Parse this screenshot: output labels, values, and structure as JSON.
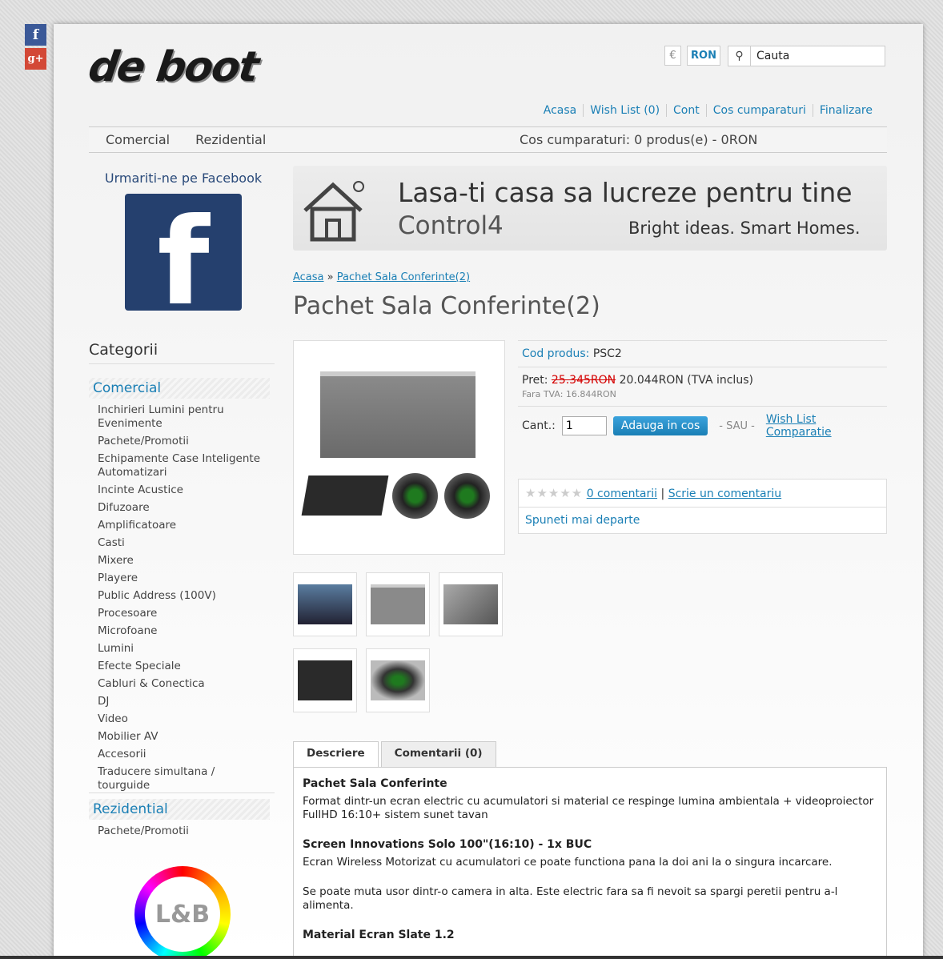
{
  "social": {
    "fb": "f",
    "gp": "g+"
  },
  "brand": {
    "logo_text": "de boot"
  },
  "currency": {
    "eur": "€",
    "ron": "RON"
  },
  "search": {
    "value": "Cauta"
  },
  "toplinks": [
    "Acasa",
    "Wish List (0)",
    "Cont",
    "Cos cumparaturi",
    "Finalizare"
  ],
  "menu": {
    "items": [
      "Comercial",
      "Rezidential"
    ],
    "cart": "Cos cumparaturi: 0 produs(e) - 0RON"
  },
  "facebook": {
    "title": "Urmariti-ne pe Facebook",
    "letter": "f"
  },
  "categories": {
    "heading": "Categorii",
    "comercial": {
      "title": "Comercial",
      "items": [
        "Inchirieri Lumini pentru Evenimente",
        "Pachete/Promotii",
        "Echipamente Case Inteligente Automatizari",
        "Incinte Acustice",
        "Difuzoare",
        "Amplificatoare",
        "Casti",
        "Mixere",
        "Playere",
        "Public Address (100V)",
        "Procesoare",
        "Microfoane",
        "Lumini",
        "Efecte Speciale",
        "Cabluri & Conectica",
        "DJ",
        "Video",
        "Mobilier AV",
        "Accesorii",
        "Traducere simultana / tourguide"
      ]
    },
    "rezidential": {
      "title": "Rezidential",
      "items": [
        "Pachete/Promotii"
      ]
    }
  },
  "lb_logo": "L&B",
  "banner": {
    "line1": "Lasa-ti casa sa lucreze pentru tine",
    "line2": "Control4",
    "line3": "Bright ideas. Smart Homes."
  },
  "breadcrumb": {
    "home": "Acasa",
    "sep": "»",
    "current": "Pachet Sala Conferinte(2)"
  },
  "product": {
    "title": "Pachet Sala Conferinte(2)",
    "code_label": "Cod produs:",
    "code": "PSC2",
    "price_label": "Pret:",
    "old_price": "25.345RON",
    "price": "20.044RON (TVA inclus)",
    "no_vat": "Fara TVA: 16.844RON",
    "qty_label": "Cant.:",
    "qty": "1",
    "add_button": "Adauga in cos",
    "or": "- SAU -",
    "wishlist": "Wish List",
    "compare": "Comparatie",
    "comments": "0 comentarii",
    "write": "Scrie un comentariu",
    "pipe": "|",
    "share": "Spuneti mai departe"
  },
  "tabs": [
    "Descriere",
    "Comentarii (0)"
  ],
  "description": {
    "h1": "Pachet Sala Conferinte",
    "p1": "Format dintr-un ecran electric cu acumulatori si material ce respinge lumina ambientala + videoproiector FullHD 16:10+ sistem sunet tavan",
    "h2": "Screen Innovations Solo 100\"(16:10) - 1x BUC",
    "p2": "Ecran Wireless Motorizat cu acumulatori ce poate functiona pana la doi ani la o singura incarcare.",
    "p3": "Se poate muta usor dintr-o camera in alta. Este electric fara sa fi nevoit sa spargi peretii pentru a-l alimenta.",
    "h3": "Material Ecran Slate 1.2"
  }
}
